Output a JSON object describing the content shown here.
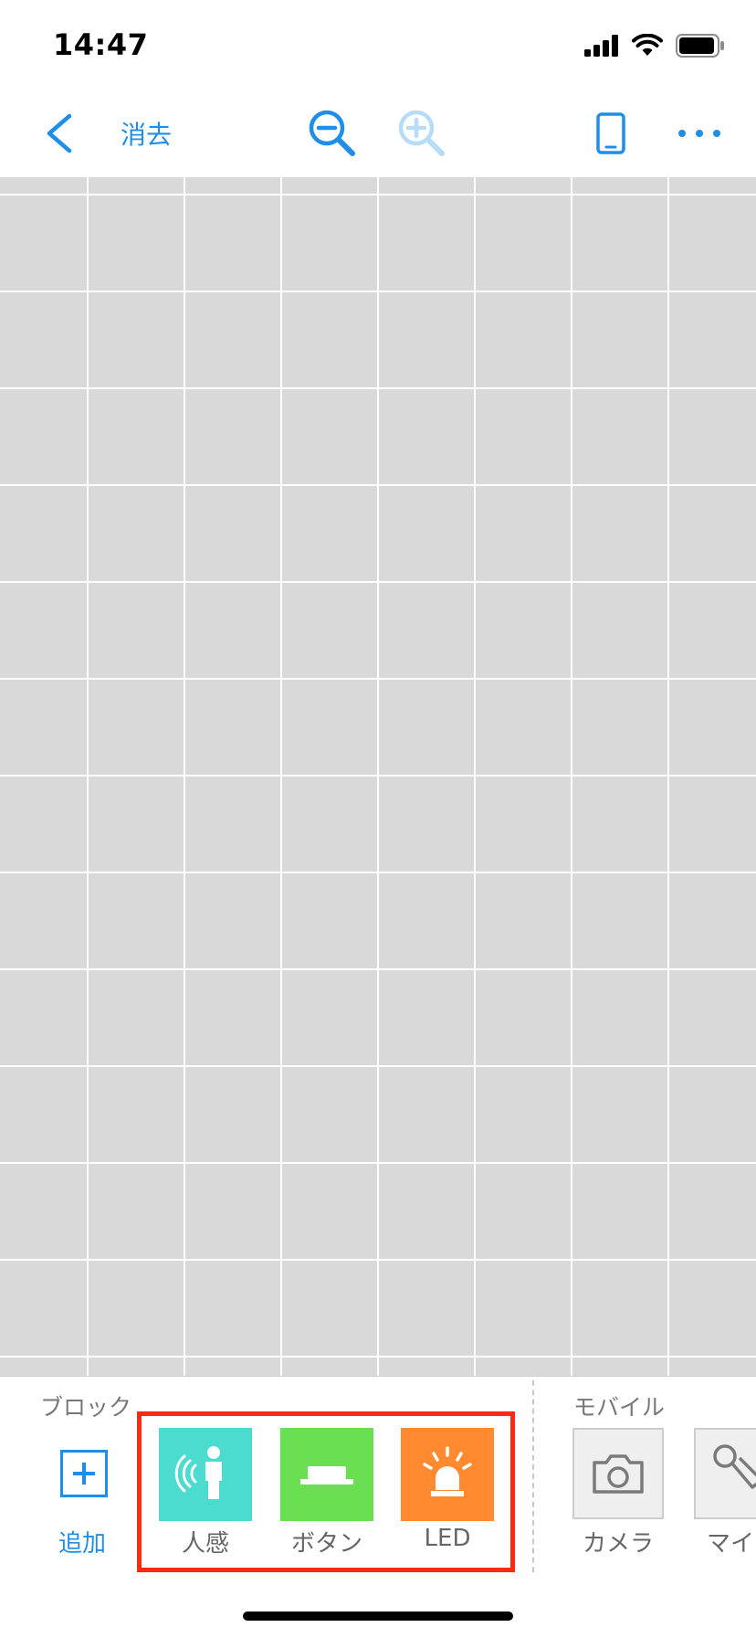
{
  "status_bar": {
    "time": "14:47"
  },
  "nav": {
    "clear_label": "消去"
  },
  "palette": {
    "block_section_label": "ブロック",
    "mobile_section_label": "モバイル",
    "add_label": "追加",
    "blocks": [
      {
        "label": "人感",
        "color": "#4cdbcf",
        "icon": "motion-sensor-icon"
      },
      {
        "label": "ボタン",
        "color": "#6adf52",
        "icon": "push-button-icon"
      },
      {
        "label": "LED",
        "color": "#ff8a30",
        "icon": "led-alarm-icon"
      }
    ],
    "mobile": [
      {
        "label": "カメラ",
        "icon": "camera-icon"
      },
      {
        "label": "マイク",
        "icon": "microphone-icon"
      }
    ]
  },
  "colors": {
    "accent": "#1e8ee9",
    "highlight": "#ff2a14",
    "grid_bg": "#d9d9d9"
  }
}
